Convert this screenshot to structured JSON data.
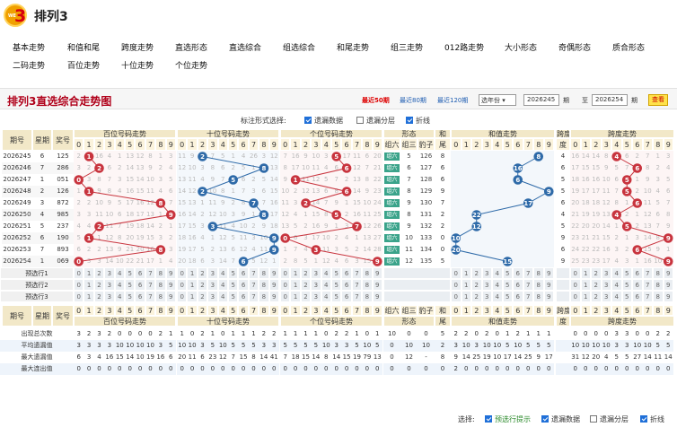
{
  "header": {
    "logo_text": "WE",
    "logo_num": "3",
    "title": "排列3"
  },
  "nav": [
    "基本走势",
    "和值和尾",
    "跨度走势",
    "直选形态",
    "直选综合",
    "组选综合",
    "和尾走势",
    "组三走势",
    "012路走势",
    "大小形态",
    "奇偶形态",
    "质合形态",
    "二码走势",
    "百位走势",
    "十位走势",
    "个位走势"
  ],
  "nav_active": 4,
  "chart_title": "排列3直选综合走势图",
  "periods": {
    "p50": "最近50期",
    "p80": "最近80期",
    "p120": "最近120期",
    "select": "选年份",
    "from": "2026245",
    "label_from": "期",
    "to_label": "至",
    "to": "2026254",
    "label_to": "期",
    "query": "查看"
  },
  "options": {
    "label": "标注形式选择:",
    "o1": "遗漏数据",
    "o2": "遗漏分层",
    "o3": "折线"
  },
  "colors": {
    "accent": "#d7000f",
    "red": "#c8343e",
    "blue": "#2e6aa8",
    "header": "#f2e8c8"
  },
  "grid": {
    "head1": {
      "qi": "期号",
      "wk": "星期",
      "jh": "奖号",
      "bai": "百位号码走势",
      "shi": "十位号码走势",
      "ge": "个位号码走势",
      "xt": "形态",
      "hw": "和尾",
      "hz": "和值走势",
      "kdh": "跨度",
      "kd": "跨度走势"
    },
    "head2": {
      "d": [
        "0",
        "1",
        "2",
        "3",
        "4",
        "5",
        "6",
        "7",
        "8",
        "9"
      ],
      "xt": [
        "组六",
        "组三",
        "豹子"
      ],
      "he": "和",
      "wei": "尾",
      "kd": "度",
      "kdd": [
        "0",
        "1",
        "2",
        "3",
        "4",
        "5",
        "6",
        "7",
        "8",
        "9"
      ]
    },
    "rows": [
      {
        "qi": "2026245",
        "wk": "6",
        "jh": "125",
        "b": [
          2,
          1,
          16,
          4,
          1,
          13,
          12,
          8,
          1,
          3
        ],
        "s": [
          11,
          9,
          2,
          7,
          5,
          1,
          4,
          26,
          3,
          12
        ],
        "g": [
          7,
          16,
          9,
          10,
          3,
          5,
          17,
          11,
          6,
          20
        ],
        "xt": [
          "组六",
          "5",
          "126"
        ],
        "hz": 8,
        "hw": 8,
        "kd": 4,
        "kdv": [
          16,
          14,
          14,
          8,
          4,
          6,
          2,
          7,
          1,
          3
        ]
      },
      {
        "qi": "2026246",
        "wk": "7",
        "jh": "286",
        "b": [
          3,
          2,
          7,
          6,
          2,
          14,
          13,
          9,
          2,
          4
        ],
        "s": [
          12,
          10,
          3,
          8,
          6,
          2,
          5,
          1,
          4,
          13
        ],
        "g": [
          8,
          17,
          10,
          11,
          4,
          6,
          1,
          12,
          7,
          21
        ],
        "xt": [
          "组六",
          "6",
          "127"
        ],
        "hz": 16,
        "hw": 6,
        "kd": 6,
        "kdv": [
          17,
          15,
          15,
          9,
          5,
          7,
          6,
          8,
          2,
          4
        ]
      },
      {
        "qi": "2026247",
        "wk": "1",
        "jh": "051",
        "b": [
          0,
          3,
          8,
          7,
          3,
          15,
          14,
          10,
          3,
          5
        ],
        "s": [
          13,
          11,
          4,
          9,
          7,
          5,
          6,
          2,
          5,
          14
        ],
        "g": [
          9,
          1,
          11,
          12,
          5,
          7,
          2,
          13,
          8,
          22
        ],
        "xt": [
          "组六",
          "7",
          "128"
        ],
        "hz": 6,
        "hw": 6,
        "kd": 5,
        "kdv": [
          18,
          16,
          16,
          10,
          6,
          5,
          1,
          9,
          3,
          5
        ]
      },
      {
        "qi": "2026248",
        "wk": "2",
        "jh": "126",
        "b": [
          1,
          1,
          9,
          8,
          4,
          16,
          15,
          11,
          4,
          6
        ],
        "s": [
          14,
          12,
          2,
          10,
          8,
          1,
          7,
          3,
          6,
          15
        ],
        "g": [
          10,
          2,
          12,
          13,
          6,
          8,
          6,
          14,
          9,
          23
        ],
        "xt": [
          "组六",
          "8",
          "129"
        ],
        "hz": 9,
        "hw": 9,
        "kd": 5,
        "kdv": [
          19,
          17,
          17,
          11,
          7,
          5,
          2,
          10,
          4,
          6
        ]
      },
      {
        "qi": "2026249",
        "wk": "3",
        "jh": "872",
        "b": [
          2,
          2,
          10,
          9,
          5,
          17,
          16,
          12,
          8,
          7
        ],
        "s": [
          15,
          13,
          1,
          11,
          9,
          2,
          8,
          7,
          7,
          16
        ],
        "g": [
          11,
          3,
          2,
          14,
          7,
          9,
          1,
          15,
          10,
          24
        ],
        "xt": [
          "组六",
          "9",
          "130"
        ],
        "hz": 17,
        "hw": 7,
        "kd": 6,
        "kdv": [
          20,
          18,
          18,
          12,
          8,
          1,
          6,
          11,
          5,
          7
        ]
      },
      {
        "qi": "2026250",
        "wk": "4",
        "jh": "985",
        "b": [
          3,
          3,
          11,
          10,
          6,
          18,
          17,
          13,
          1,
          9
        ],
        "s": [
          16,
          14,
          2,
          12,
          10,
          3,
          9,
          1,
          8,
          17
        ],
        "g": [
          12,
          4,
          1,
          15,
          8,
          5,
          2,
          16,
          11,
          25
        ],
        "xt": [
          "组六",
          "8",
          "131"
        ],
        "hz": 22,
        "hw": 2,
        "kd": 4,
        "kdv": [
          21,
          19,
          19,
          13,
          4,
          2,
          1,
          12,
          6,
          8
        ]
      },
      {
        "qi": "2026251",
        "wk": "5",
        "jh": "237",
        "b": [
          4,
          4,
          2,
          11,
          7,
          19,
          18,
          14,
          2,
          1
        ],
        "s": [
          17,
          15,
          3,
          3,
          11,
          4,
          10,
          2,
          9,
          18
        ],
        "g": [
          13,
          5,
          2,
          16,
          9,
          1,
          3,
          7,
          12,
          26
        ],
        "xt": [
          "组六",
          "9",
          "132"
        ],
        "hz": 12,
        "hw": 2,
        "kd": 5,
        "kdv": [
          22,
          20,
          20,
          14,
          1,
          5,
          2,
          13,
          7,
          9
        ]
      },
      {
        "qi": "2026252",
        "wk": "6",
        "jh": "190",
        "b": [
          5,
          1,
          1,
          12,
          8,
          20,
          19,
          15,
          3,
          2
        ],
        "s": [
          18,
          16,
          4,
          1,
          12,
          5,
          11,
          3,
          10,
          9
        ],
        "g": [
          0,
          6,
          3,
          17,
          10,
          2,
          4,
          1,
          13,
          27
        ],
        "xt": [
          "组六",
          "10",
          "133"
        ],
        "hz": 10,
        "hw": 0,
        "kd": 9,
        "kdv": [
          23,
          21,
          21,
          15,
          2,
          1,
          3,
          14,
          8,
          9
        ]
      },
      {
        "qi": "2026253",
        "wk": "7",
        "jh": "893",
        "b": [
          6,
          2,
          2,
          13,
          9,
          21,
          20,
          16,
          8,
          3
        ],
        "s": [
          19,
          17,
          5,
          2,
          13,
          6,
          12,
          4,
          11,
          9
        ],
        "g": [
          1,
          7,
          4,
          3,
          11,
          3,
          5,
          2,
          14,
          28
        ],
        "xt": [
          "组六",
          "11",
          "134"
        ],
        "hz": 20,
        "hw": 0,
        "kd": 6,
        "kdv": [
          24,
          22,
          22,
          16,
          3,
          2,
          6,
          15,
          9,
          1
        ]
      },
      {
        "qi": "2026254",
        "wk": "1",
        "jh": "069",
        "b": [
          0,
          3,
          3,
          14,
          10,
          22,
          21,
          17,
          1,
          4
        ],
        "s": [
          20,
          18,
          6,
          3,
          14,
          7,
          6,
          5,
          12,
          1
        ],
        "g": [
          2,
          8,
          5,
          1,
          12,
          4,
          6,
          3,
          15,
          9
        ],
        "xt": [
          "组六",
          "12",
          "135"
        ],
        "hz": 15,
        "hw": 5,
        "kd": 9,
        "kdv": [
          25,
          23,
          23,
          17,
          4,
          3,
          1,
          16,
          10,
          9
        ]
      }
    ],
    "predict": [
      "预选行1",
      "预选行2",
      "预选行3"
    ],
    "stats": [
      {
        "label": "出现总次数",
        "b": [
          "3",
          "2",
          "3",
          "2",
          "0",
          "0",
          "0",
          "0",
          "2",
          "1"
        ],
        "s": [
          "1",
          "0",
          "2",
          "1",
          "0",
          "1",
          "1",
          "1",
          "2",
          "2"
        ],
        "g": [
          "1",
          "1",
          "1",
          "1",
          "0",
          "2",
          "2",
          "1",
          "0",
          "1"
        ],
        "xt": [
          "10",
          "0",
          "0"
        ],
        "hw": [
          "5"
        ],
        "hz": [
          "2",
          "2",
          "0",
          "2",
          "0",
          "1",
          "2",
          "1",
          "1",
          "1"
        ],
        "kd": [
          "0",
          "0",
          "0",
          "0",
          "3",
          "3",
          "0",
          "0",
          "2",
          "2"
        ]
      },
      {
        "label": "平均遗漏值",
        "b": [
          "3",
          "3",
          "3",
          "3",
          "10",
          "10",
          "10",
          "10",
          "3",
          "5"
        ],
        "s": [
          "10",
          "10",
          "3",
          "5",
          "10",
          "5",
          "5",
          "5",
          "3",
          "3"
        ],
        "g": [
          "5",
          "5",
          "5",
          "5",
          "10",
          "3",
          "3",
          "5",
          "10",
          "5"
        ],
        "xt": [
          "0",
          "10",
          "10"
        ],
        "hw": [
          "2"
        ],
        "hz": [
          "3",
          "10",
          "3",
          "10",
          "10",
          "5",
          "10",
          "5",
          "5",
          "5"
        ],
        "kd": [
          "10",
          "10",
          "10",
          "10",
          "3",
          "3",
          "10",
          "10",
          "5",
          "5"
        ]
      },
      {
        "label": "最大遗漏值",
        "b": [
          "6",
          "3",
          "4",
          "16",
          "15",
          "14",
          "10",
          "19",
          "16",
          "6"
        ],
        "s": [
          "20",
          "11",
          "6",
          "23",
          "12",
          "7",
          "15",
          "8",
          "14",
          "41"
        ],
        "g": [
          "7",
          "18",
          "15",
          "14",
          "8",
          "14",
          "15",
          "19",
          "79",
          "13"
        ],
        "xt": [
          "0",
          "12",
          "-"
        ],
        "hw": [
          "8"
        ],
        "hz": [
          "9",
          "14",
          "25",
          "19",
          "10",
          "17",
          "14",
          "25",
          "9",
          "17"
        ],
        "kd": [
          "31",
          "12",
          "20",
          "4",
          "5",
          "5",
          "27",
          "14",
          "11",
          "14"
        ]
      },
      {
        "label": "最大连出值",
        "b": [
          "0",
          "0",
          "0",
          "0",
          "0",
          "0",
          "0",
          "0",
          "0",
          "0"
        ],
        "s": [
          "0",
          "0",
          "0",
          "0",
          "0",
          "0",
          "0",
          "0",
          "0",
          "0"
        ],
        "g": [
          "0",
          "0",
          "0",
          "0",
          "0",
          "0",
          "0",
          "0",
          "0",
          "0"
        ],
        "xt": [
          "0",
          "0",
          "0"
        ],
        "hw": [
          "0"
        ],
        "hz": [
          "2",
          "0",
          "0",
          "0",
          "0",
          "0",
          "0",
          "0",
          "0",
          "0"
        ],
        "kd": [
          "0",
          "0",
          "0",
          "0",
          "0",
          "0",
          "0",
          "0",
          "0",
          "0"
        ]
      }
    ]
  },
  "footer": {
    "label": "选择:",
    "o1": "预选行提示",
    "o2": "遗漏数据",
    "o3": "遗漏分层",
    "o4": "折线"
  }
}
